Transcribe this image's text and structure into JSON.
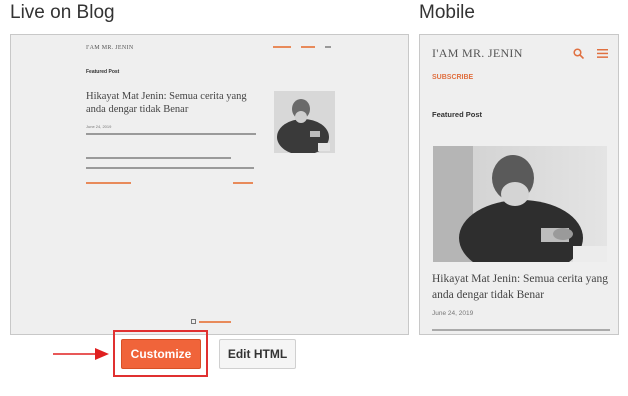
{
  "sections": {
    "live_title": "Live on Blog",
    "mobile_title": "Mobile"
  },
  "desktop_preview": {
    "blog_name": "I'AM MR. JENIN",
    "featured_label": "Featured Post",
    "post_title": "Hikayat Mat Jenin: Semua cerita yang anda dengar tidak Benar",
    "post_date": "June 24, 2019"
  },
  "mobile_preview": {
    "blog_name": "I'AM MR. JENIN",
    "subscribe_label": "SUBSCRIBE",
    "featured_label": "Featured Post",
    "post_title": "Hikayat Mat Jenin: Semua cerita yang anda dengar tidak Benar",
    "post_date": "June 24, 2019"
  },
  "actions": {
    "customize_label": "Customize",
    "edit_html_label": "Edit HTML"
  },
  "colors": {
    "accent": "#f0643a",
    "highlight": "#e03030",
    "link": "#e07040"
  },
  "icons": [
    "search-icon",
    "menu-icon",
    "arrow-right-icon",
    "blogger-icon"
  ]
}
